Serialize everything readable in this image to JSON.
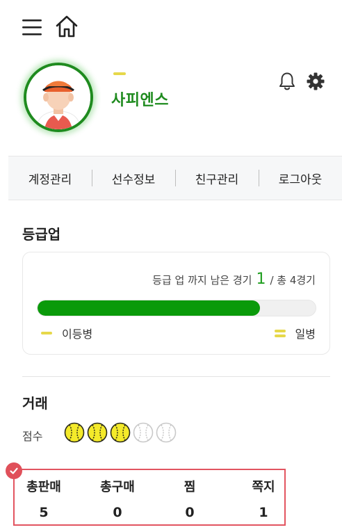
{
  "header": {
    "menu_icon": "hamburger-menu-icon",
    "home_icon": "home-icon"
  },
  "profile": {
    "avatar": "baseball-player-avatar",
    "rank_mark": "dash",
    "name": "사피엔스",
    "bell_icon": "bell-icon",
    "gear_icon": "gear-icon"
  },
  "tabs": [
    {
      "label": "계정관리"
    },
    {
      "label": "선수정보"
    },
    {
      "label": "친구관리"
    },
    {
      "label": "로그아웃"
    }
  ],
  "grade": {
    "title": "등급업",
    "info_prefix": "등급 업 까지 남은 경기",
    "remaining": "1",
    "info_suffix": "/ 총 4경기",
    "progress_fraction": 0.8,
    "current_rank": "이등병",
    "next_rank": "일병",
    "progress_color": "#0a9a0a",
    "rank_mark_color": "#e6d84a"
  },
  "trade": {
    "title": "거래",
    "score_label": "점수",
    "score_filled": 3,
    "score_total": 5,
    "ball_filled_color": "#f4ea2a",
    "stats": [
      {
        "label": "총판매",
        "value": "5"
      },
      {
        "label": "총구매",
        "value": "0"
      },
      {
        "label": "찜",
        "value": "0"
      },
      {
        "label": "쪽지",
        "value": "1"
      }
    ],
    "highlight_color": "#e25460"
  }
}
